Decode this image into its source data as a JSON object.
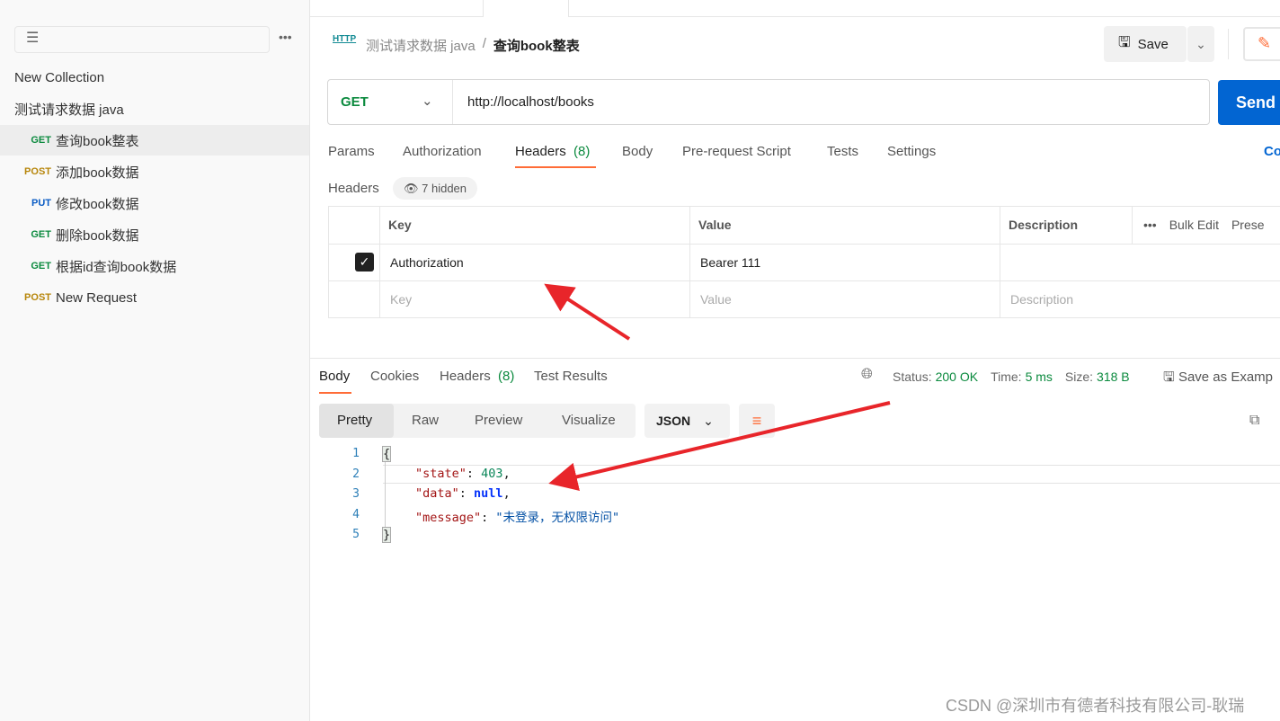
{
  "sidebar": {
    "collection": "New Collection",
    "folder": "测试请求数据 java",
    "items": [
      {
        "method": "GET",
        "name": "查询book整表",
        "color": "#0b8a3e",
        "active": true
      },
      {
        "method": "POST",
        "name": "添加book数据",
        "color": "#b7860b"
      },
      {
        "method": "PUT",
        "name": "修改book数据",
        "color": "#0b5cc4"
      },
      {
        "method": "GET",
        "name": "删除book数据",
        "color": "#0b8a3e"
      },
      {
        "method": "GET",
        "name": "根据id查询book数据",
        "color": "#0b8a3e"
      },
      {
        "method": "POST",
        "name": "New Request",
        "color": "#b7860b"
      }
    ]
  },
  "breadcrumb": {
    "icon": "HTTP",
    "parent": "测试请求数据 java",
    "sep": "/",
    "current": "查询book整表"
  },
  "toolbar": {
    "save": "Save"
  },
  "request": {
    "method": "GET",
    "url": "http://localhost/books",
    "send": "Send"
  },
  "req_tabs": [
    "Params",
    "Authorization",
    "Headers",
    "(8)",
    "Body",
    "Pre-request Script",
    "Tests",
    "Settings",
    "Co"
  ],
  "headers": {
    "label": "Headers",
    "hidden": "7 hidden",
    "cols": [
      "Key",
      "Value",
      "Description"
    ],
    "bulk": "Bulk Edit",
    "presets": "Prese",
    "rows": [
      {
        "key": "Authorization",
        "value": "Bearer 111",
        "checked": true
      }
    ],
    "placeholder": {
      "key": "Key",
      "value": "Value",
      "desc": "Description"
    }
  },
  "response": {
    "tabs": [
      "Body",
      "Cookies",
      "Headers",
      "(8)",
      "Test Results"
    ],
    "status_label": "Status:",
    "status": "200 OK",
    "time_label": "Time:",
    "time": "5 ms",
    "size_label": "Size:",
    "size": "318 B",
    "save_example": "Save as Examp",
    "views": [
      "Pretty",
      "Raw",
      "Preview",
      "Visualize"
    ],
    "format": "JSON",
    "lines": [
      "1",
      "2",
      "3",
      "4",
      "5"
    ],
    "code": {
      "open": "{",
      "k1": "\"state\"",
      "v1": "403",
      "k2": "\"data\"",
      "v2": "null",
      "k3": "\"message\"",
      "v3": "\"未登录，无权限访问\"",
      "close": "}"
    }
  },
  "watermark": "CSDN @深圳市有德者科技有限公司-耿瑞",
  "colors": {
    "accent": "#ff6c37",
    "send": "#0265d2",
    "success": "#0b8a3e",
    "annotation": "#e8252a"
  }
}
